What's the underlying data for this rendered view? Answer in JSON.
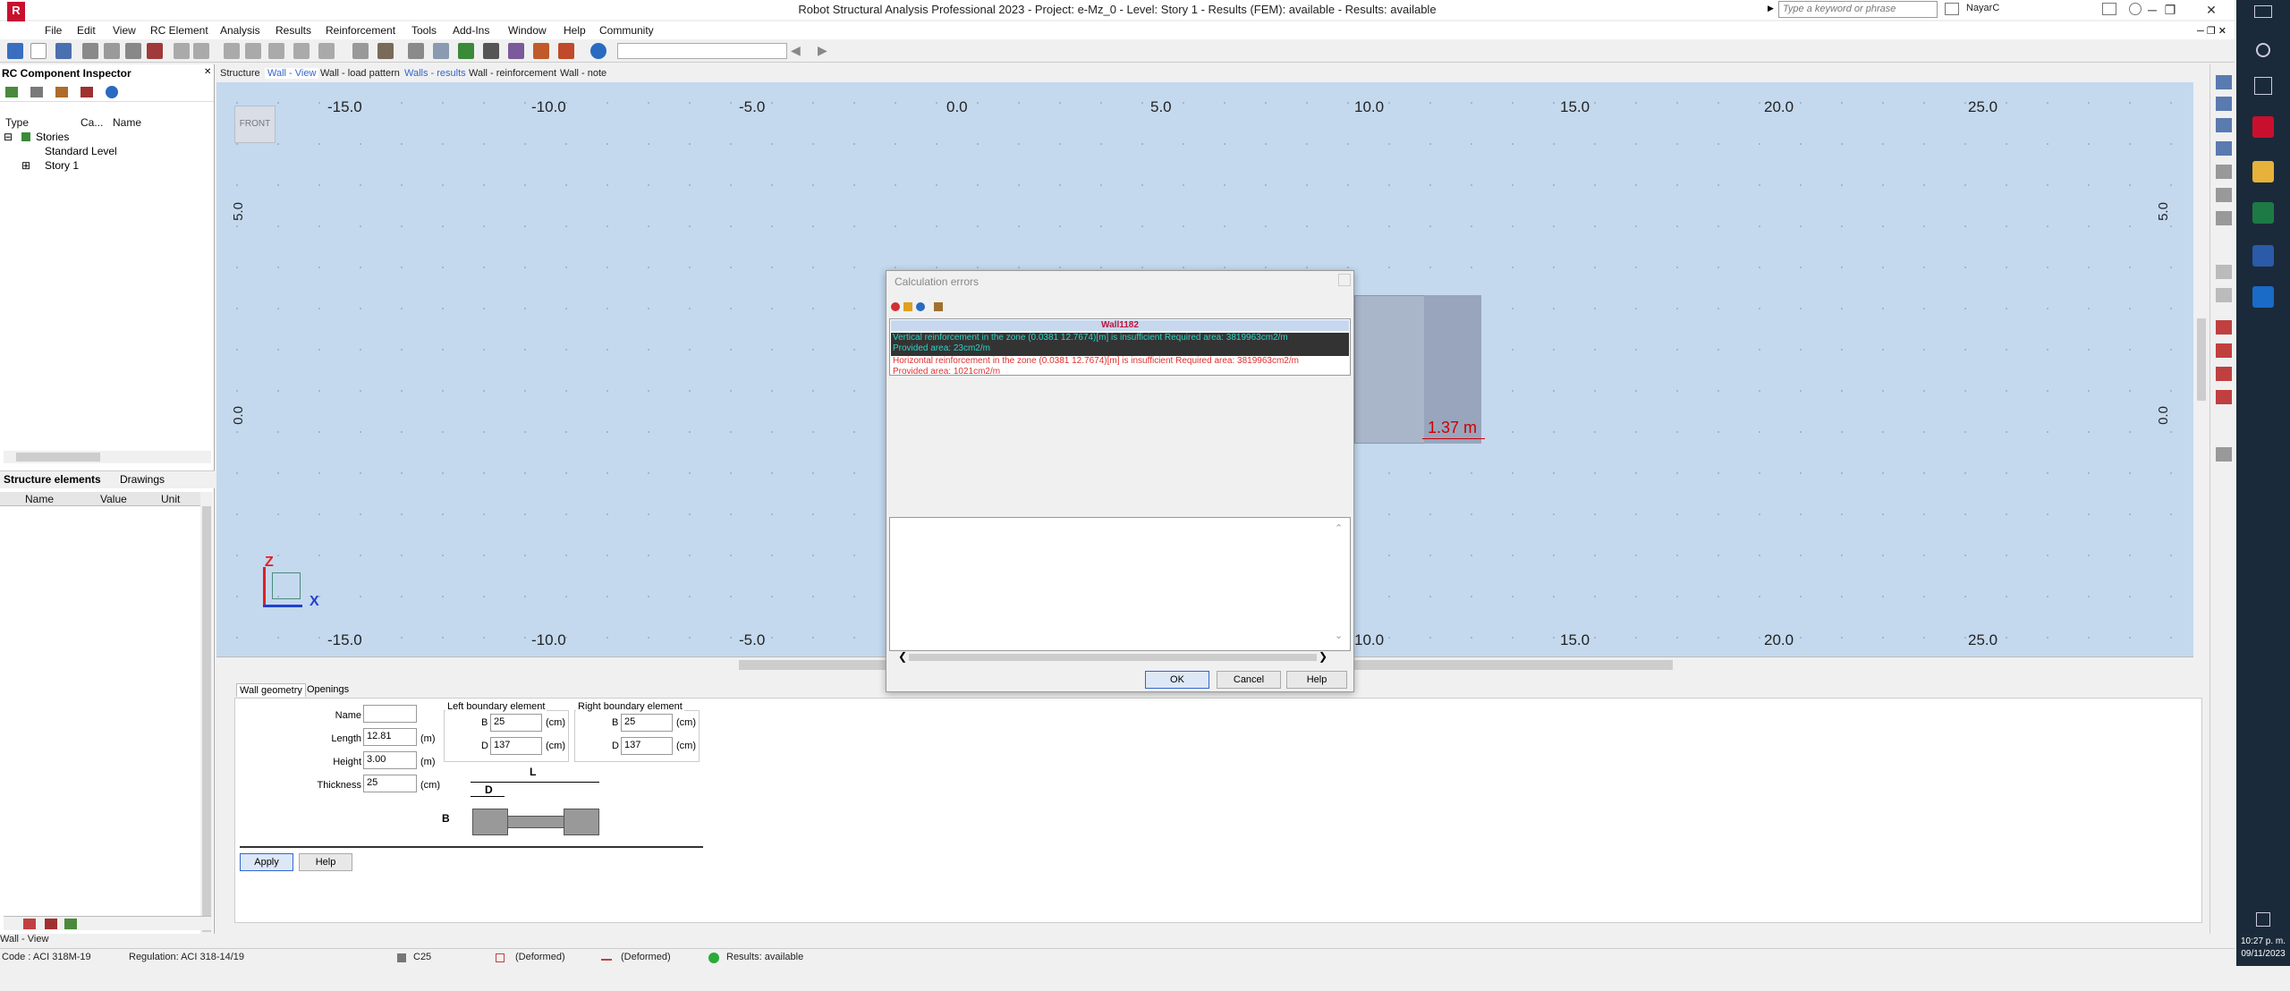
{
  "title_bar": {
    "app_title": "Robot Structural Analysis Professional 2023 - Project: e-Mz_0 - Level: Story 1 - Results (FEM): available - Results: available",
    "search_placeholder": "Type a keyword or phrase",
    "user": "NayarC"
  },
  "menu": [
    "File",
    "Edit",
    "View",
    "RC Element",
    "Analysis",
    "Results",
    "Reinforcement",
    "Tools",
    "Add-Ins",
    "Window",
    "Help",
    "Community"
  ],
  "inspector": {
    "title": "RC Component Inspector",
    "columns": {
      "type": "Type",
      "ca": "Ca...",
      "name": "Name"
    },
    "tree": {
      "root": "Stories",
      "child1": "Standard Level",
      "child2": "Story 1"
    },
    "bottom_tabs": {
      "structure": "Structure elements",
      "drawings": "Drawings"
    },
    "table_cols": {
      "name": "Name",
      "value": "Value",
      "unit": "Unit"
    }
  },
  "view_tabs": [
    "Structure",
    "Wall - View",
    "Wall - load pattern",
    "Walls - results",
    "Wall - reinforcement",
    "Wall - note"
  ],
  "viewport": {
    "front_label": "FRONT",
    "x_ticks": [
      "-15.0",
      "-10.0",
      "-5.0",
      "0.0",
      "5.0",
      "10.0",
      "15.0",
      "20.0",
      "25.0"
    ],
    "y_ticks": [
      "5.0",
      "0.0"
    ],
    "dimension": "1.37 m",
    "axis_z": "Z",
    "axis_x": "X"
  },
  "dialog": {
    "title": "Calculation errors",
    "element": "Wall1182",
    "error1_line1": "Vertical reinforcement in the zone (0.0381 12.7674)[m] is insufficient Required area: 3819963cm2/m",
    "error1_line2": "Provided area: 23cm2/m",
    "error2_line1": "Horizontal reinforcement in the zone (0.0381 12.7674)[m] is insufficient Required area: 3819963cm2/m",
    "error2_line2": "Provided area: 1021cm2/m",
    "ok": "OK",
    "cancel": "Cancel",
    "help": "Help"
  },
  "wall_form": {
    "tabs": {
      "geometry": "Wall geometry",
      "openings": "Openings"
    },
    "name_label": "Name",
    "name_value": "",
    "length_label": "Length",
    "length_value": "12.81",
    "length_unit": "(m)",
    "height_label": "Height",
    "height_value": "3.00",
    "height_unit": "(m)",
    "thickness_label": "Thickness",
    "thickness_value": "25",
    "thickness_unit": "(cm)",
    "left_title": "Left boundary element",
    "right_title": "Right boundary element",
    "b_label": "B",
    "d_label": "D",
    "left_b": "25",
    "left_d": "137",
    "right_b": "25",
    "right_d": "137",
    "unit_cm": "(cm)",
    "diagram_l": "L",
    "diagram_d": "D",
    "diagram_b": "B",
    "apply": "Apply",
    "help": "Help"
  },
  "status": {
    "view_name": "Wall - View",
    "code": "Code : ACI 318M-19",
    "regulation": "Regulation: ACI 318-14/19",
    "concrete": "C25",
    "deformed1": "(Deformed)",
    "deformed2": "(Deformed)",
    "results": "Results: available"
  },
  "clock": {
    "time": "10:27 p. m.",
    "date": "09/11/2023"
  }
}
